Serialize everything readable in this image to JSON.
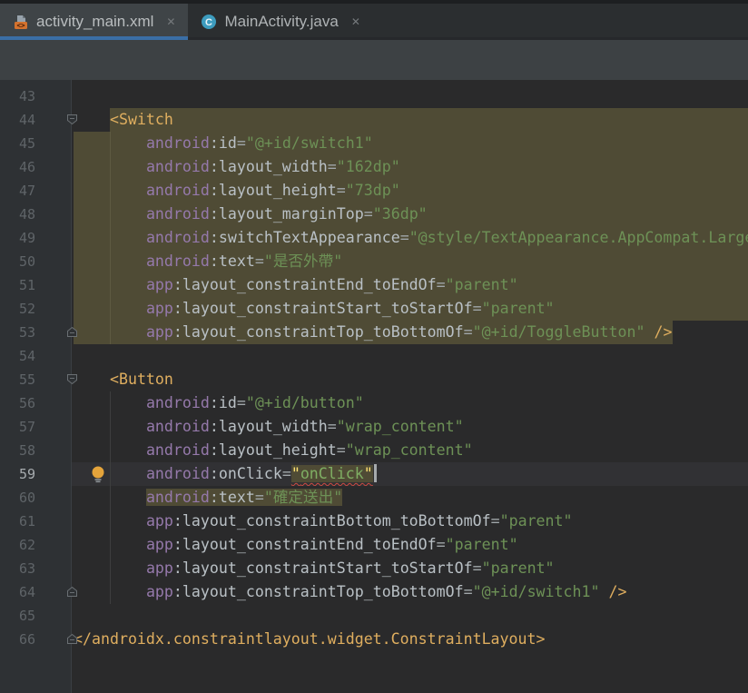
{
  "tabs": [
    {
      "label": "activity_main.xml",
      "close": "✕",
      "active": true,
      "icon": "xml-layout-file"
    },
    {
      "label": "MainActivity.java",
      "close": "✕",
      "active": false,
      "icon": "java-class"
    }
  ],
  "icons": {
    "xml_glyph": "<>",
    "java_class_letter": "C"
  },
  "colors": {
    "active_tab_underline": "#3a6ea5",
    "selection_highlight": "#4f4b35",
    "error_squiggle": "#cf4b43",
    "intention_bulb": "#e5a43b",
    "editor_background": "#2a2a2b",
    "gutter_background": "#2e3134"
  },
  "editor": {
    "lines": [
      {
        "n": 43,
        "seg": []
      },
      {
        "n": 44,
        "fold": "down",
        "hl": [
          4,
          -1
        ],
        "seg": [
          [
            "sp",
            "    "
          ],
          [
            "tag",
            "<Switch"
          ]
        ]
      },
      {
        "n": 45,
        "hl": [
          0,
          -1
        ],
        "seg": [
          [
            "sp",
            "        "
          ],
          [
            "ns",
            "android"
          ],
          [
            "pn",
            ":"
          ],
          [
            "at",
            "id"
          ],
          [
            "eq",
            "="
          ],
          [
            "st",
            "\"@+id/switch1\""
          ]
        ]
      },
      {
        "n": 46,
        "hl": [
          0,
          -1
        ],
        "seg": [
          [
            "sp",
            "        "
          ],
          [
            "ns",
            "android"
          ],
          [
            "pn",
            ":"
          ],
          [
            "at",
            "layout_width"
          ],
          [
            "eq",
            "="
          ],
          [
            "st",
            "\"162dp\""
          ]
        ]
      },
      {
        "n": 47,
        "hl": [
          0,
          -1
        ],
        "seg": [
          [
            "sp",
            "        "
          ],
          [
            "ns",
            "android"
          ],
          [
            "pn",
            ":"
          ],
          [
            "at",
            "layout_height"
          ],
          [
            "eq",
            "="
          ],
          [
            "st",
            "\"73dp\""
          ]
        ]
      },
      {
        "n": 48,
        "hl": [
          0,
          -1
        ],
        "seg": [
          [
            "sp",
            "        "
          ],
          [
            "ns",
            "android"
          ],
          [
            "pn",
            ":"
          ],
          [
            "at",
            "layout_marginTop"
          ],
          [
            "eq",
            "="
          ],
          [
            "st",
            "\"36dp\""
          ]
        ]
      },
      {
        "n": 49,
        "hl": [
          0,
          -1
        ],
        "seg": [
          [
            "sp",
            "        "
          ],
          [
            "ns",
            "android"
          ],
          [
            "pn",
            ":"
          ],
          [
            "at",
            "switchTextAppearance"
          ],
          [
            "eq",
            "="
          ],
          [
            "st",
            "\"@style/TextAppearance.AppCompat.Large\""
          ]
        ]
      },
      {
        "n": 50,
        "hl": [
          0,
          -1
        ],
        "seg": [
          [
            "sp",
            "        "
          ],
          [
            "ns",
            "android"
          ],
          [
            "pn",
            ":"
          ],
          [
            "at",
            "text"
          ],
          [
            "eq",
            "="
          ],
          [
            "st",
            "\"是否外帶\""
          ]
        ]
      },
      {
        "n": 51,
        "hl": [
          0,
          -1
        ],
        "seg": [
          [
            "sp",
            "        "
          ],
          [
            "ns",
            "app"
          ],
          [
            "pn",
            ":"
          ],
          [
            "at",
            "layout_constraintEnd_toEndOf"
          ],
          [
            "eq",
            "="
          ],
          [
            "st",
            "\"parent\""
          ]
        ]
      },
      {
        "n": 52,
        "hl": [
          0,
          -1
        ],
        "seg": [
          [
            "sp",
            "        "
          ],
          [
            "ns",
            "app"
          ],
          [
            "pn",
            ":"
          ],
          [
            "at",
            "layout_constraintStart_toStartOf"
          ],
          [
            "eq",
            "="
          ],
          [
            "st",
            "\"parent\""
          ]
        ]
      },
      {
        "n": 53,
        "fold": "up",
        "hl": [
          0,
          66
        ],
        "seg": [
          [
            "sp",
            "        "
          ],
          [
            "ns",
            "app"
          ],
          [
            "pn",
            ":"
          ],
          [
            "at",
            "layout_constraintTop_toBottomOf"
          ],
          [
            "eq",
            "="
          ],
          [
            "st",
            "\"@+id/ToggleButton\""
          ],
          [
            "sp",
            " "
          ],
          [
            "tag",
            "/>"
          ]
        ]
      },
      {
        "n": 54,
        "seg": []
      },
      {
        "n": 55,
        "fold": "down",
        "seg": [
          [
            "sp",
            "    "
          ],
          [
            "tag",
            "<Button"
          ]
        ]
      },
      {
        "n": 56,
        "seg": [
          [
            "sp",
            "        "
          ],
          [
            "ns",
            "android"
          ],
          [
            "pn",
            ":"
          ],
          [
            "at",
            "id"
          ],
          [
            "eq",
            "="
          ],
          [
            "st",
            "\"@+id/button\""
          ]
        ]
      },
      {
        "n": 57,
        "seg": [
          [
            "sp",
            "        "
          ],
          [
            "ns",
            "android"
          ],
          [
            "pn",
            ":"
          ],
          [
            "at",
            "layout_width"
          ],
          [
            "eq",
            "="
          ],
          [
            "st",
            "\"wrap_content\""
          ]
        ]
      },
      {
        "n": 58,
        "seg": [
          [
            "sp",
            "        "
          ],
          [
            "ns",
            "android"
          ],
          [
            "pn",
            ":"
          ],
          [
            "at",
            "layout_height"
          ],
          [
            "eq",
            "="
          ],
          [
            "st",
            "\"wrap_content\""
          ]
        ]
      },
      {
        "n": 59,
        "bulb": 1,
        "current": 1,
        "seg": [
          [
            "sp",
            "        "
          ],
          [
            "ns",
            "android"
          ],
          [
            "pn",
            ":"
          ],
          [
            "at",
            "onClick"
          ],
          [
            "eq",
            "="
          ],
          [
            "yq h sq",
            "\""
          ],
          [
            "stb h sq",
            "onClick"
          ],
          [
            "yq h sq",
            "\""
          ],
          [
            "caret",
            ""
          ]
        ]
      },
      {
        "n": 60,
        "seg": [
          [
            "sp",
            "        "
          ],
          [
            "ns h",
            "android"
          ],
          [
            "pn h",
            ":"
          ],
          [
            "at h",
            "text"
          ],
          [
            "eq h",
            "="
          ],
          [
            "st h",
            "\"確定送出\""
          ]
        ]
      },
      {
        "n": 61,
        "seg": [
          [
            "sp",
            "        "
          ],
          [
            "ns",
            "app"
          ],
          [
            "pn",
            ":"
          ],
          [
            "at",
            "layout_constraintBottom_toBottomOf"
          ],
          [
            "eq",
            "="
          ],
          [
            "st",
            "\"parent\""
          ]
        ]
      },
      {
        "n": 62,
        "seg": [
          [
            "sp",
            "        "
          ],
          [
            "ns",
            "app"
          ],
          [
            "pn",
            ":"
          ],
          [
            "at",
            "layout_constraintEnd_toEndOf"
          ],
          [
            "eq",
            "="
          ],
          [
            "st",
            "\"parent\""
          ]
        ]
      },
      {
        "n": 63,
        "seg": [
          [
            "sp",
            "        "
          ],
          [
            "ns",
            "app"
          ],
          [
            "pn",
            ":"
          ],
          [
            "at",
            "layout_constraintStart_toStartOf"
          ],
          [
            "eq",
            "="
          ],
          [
            "st",
            "\"parent\""
          ]
        ]
      },
      {
        "n": 64,
        "fold": "up",
        "seg": [
          [
            "sp",
            "        "
          ],
          [
            "ns",
            "app"
          ],
          [
            "pn",
            ":"
          ],
          [
            "at",
            "layout_constraintTop_toBottomOf"
          ],
          [
            "eq",
            "="
          ],
          [
            "st",
            "\"@+id/switch1\""
          ],
          [
            "sp",
            " "
          ],
          [
            "tag",
            "/>"
          ]
        ]
      },
      {
        "n": 65,
        "seg": []
      },
      {
        "n": 66,
        "fold": "up",
        "seg": [
          [
            "tag",
            "</androidx.constraintlayout.widget.ConstraintLayout>"
          ]
        ]
      }
    ]
  }
}
